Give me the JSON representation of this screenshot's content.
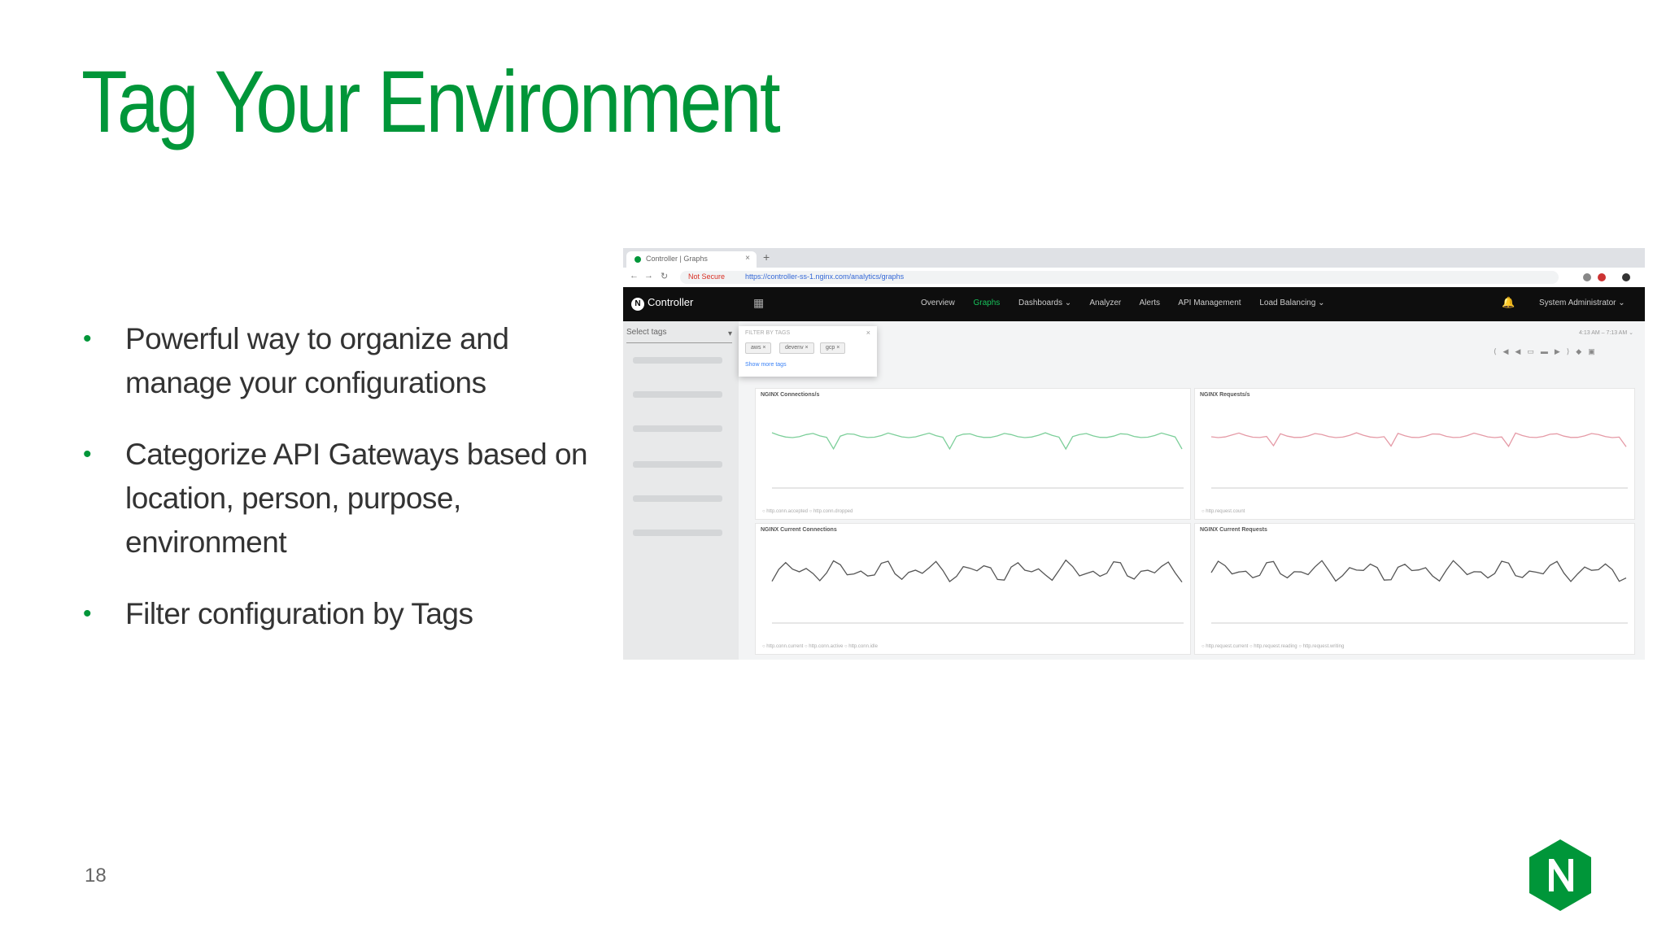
{
  "slide": {
    "title": "Tag Your Environment",
    "bullets": [
      "Powerful way to organize and manage your configurations",
      "Categorize API Gateways based on location, person, purpose, environment",
      "Filter configuration by Tags"
    ],
    "page_number": "18"
  },
  "colors": {
    "accent": "#009639",
    "nav_bg": "#0e0e0e",
    "active_nav": "#17c15a"
  },
  "screenshot": {
    "browser": {
      "tab_label": "Controller | Graphs",
      "url_warning": "Not Secure",
      "url": "https://controller-ss-1.nginx.com/analytics/graphs"
    },
    "app": {
      "brand": "Controller",
      "menu": [
        "Overview",
        "Graphs",
        "Dashboards ⌄",
        "Analyzer",
        "Alerts",
        "API Management",
        "Load Balancing ⌄"
      ],
      "active_menu": "Graphs",
      "user": "System Administrator ⌄"
    },
    "sidebar": {
      "select_label": "Select tags"
    },
    "tag_popup": {
      "header": "FILTER BY TAGS",
      "chips": [
        "aws ×",
        "devenv ×",
        "gcp ×"
      ],
      "more_link": "Show more tags"
    },
    "time_range": "4:13 AM – 7:13 AM ⌄",
    "panels": [
      {
        "title": "NGINX Connections/s",
        "legend": "○ http.conn.accepted   ○ http.conn.dropped",
        "color": "#7dcf9a"
      },
      {
        "title": "NGINX Requests/s",
        "legend": "○ http.request.count",
        "color": "#e59aa6"
      },
      {
        "title": "NGINX Current Connections",
        "legend": "○ http.conn.current   ○ http.conn.active   ○ http.conn.idle",
        "color": "#555555"
      },
      {
        "title": "NGINX Current Requests",
        "legend": "○ http.request.current   ○ http.request.reading   ○ http.request.writing",
        "color": "#555555"
      }
    ]
  }
}
